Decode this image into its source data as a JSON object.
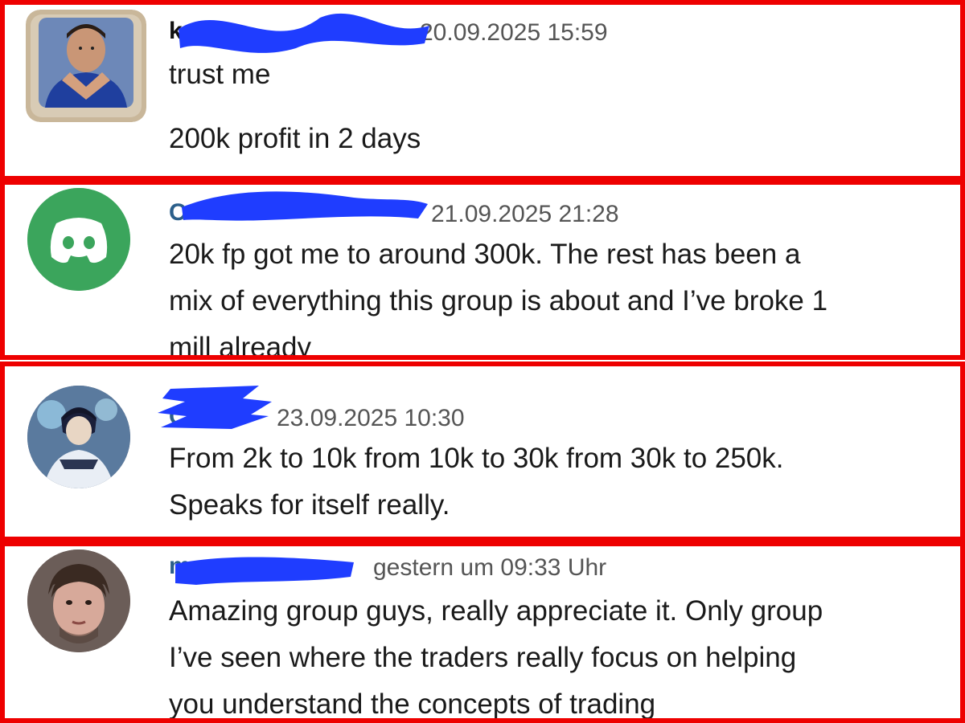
{
  "messages": [
    {
      "username": "k",
      "timestamp": "20.09.2025 15:59",
      "lines": [
        "trust me",
        "200k profit in 2 days"
      ],
      "avatar_icon": "user-photo-hands-heart"
    },
    {
      "username": "C",
      "timestamp": "21.09.2025 21:28",
      "lines": [
        "20k fp got me to around 300k. The rest has been a",
        "mix of everything this group is about and I’ve broke 1",
        "mill already"
      ],
      "avatar_icon": "discord-default-avatar-icon"
    },
    {
      "username": "C",
      "timestamp": "23.09.2025 10:30",
      "lines": [
        "From 2k to 10k from 10k to 30k from 30k to 250k.",
        "Speaks for itself really."
      ],
      "avatar_icon": "anime-character-avatar"
    },
    {
      "username": "m",
      "timestamp": "gestern um 09:33 Uhr",
      "lines": [
        "Amazing group guys, really appreciate it. Only group",
        "I’ve seen where the traders really focus on helping",
        "you understand the concepts of trading"
      ],
      "avatar_icon": "user-photo-face"
    }
  ],
  "colors": {
    "frame": "#ee0000",
    "redaction": "#1f3dff",
    "discord_green": "#3ba55c",
    "timestamp": "#555555",
    "text": "#1a1a1a"
  }
}
